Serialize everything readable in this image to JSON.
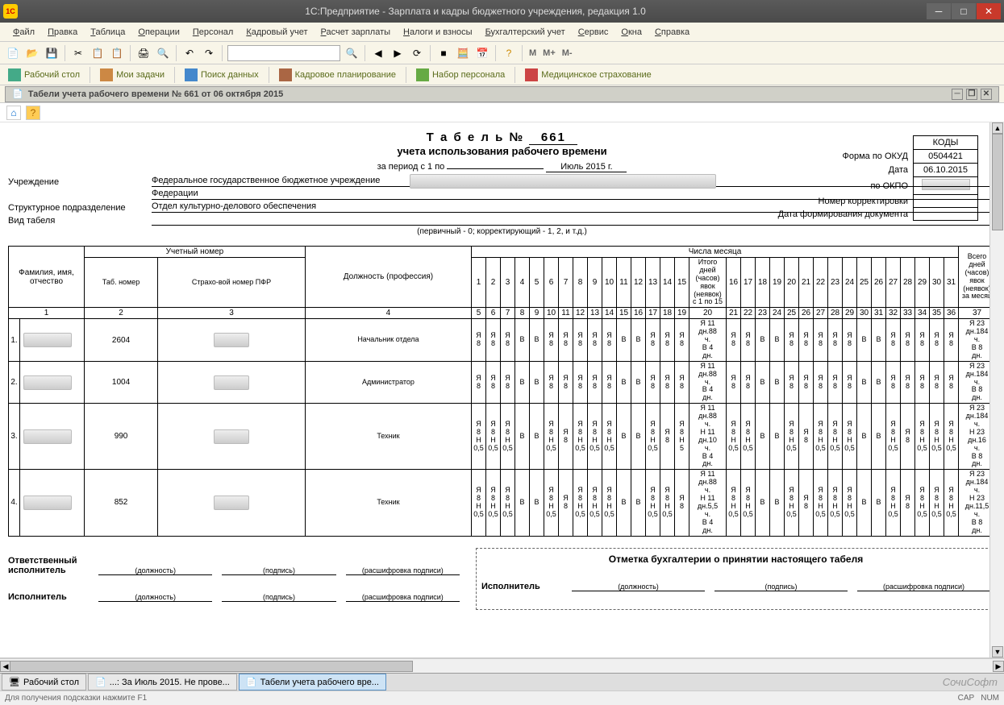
{
  "window": {
    "title": "1С:Предприятие - Зарплата и кадры бюджетного учреждения, редакция 1.0"
  },
  "menu": [
    "Файл",
    "Правка",
    "Таблица",
    "Операции",
    "Персонал",
    "Кадровый учет",
    "Расчет зарплаты",
    "Налоги и взносы",
    "Бухгалтерский учет",
    "Сервис",
    "Окна",
    "Справка"
  ],
  "toolbar": {
    "m": "M",
    "mp": "M+",
    "mm": "M-"
  },
  "toolbar2": {
    "desktop": "Рабочий стол",
    "tasks": "Мои задачи",
    "search": "Поиск данных",
    "plan": "Кадровое планирование",
    "recruit": "Набор персонала",
    "med": "Медицинское страхование"
  },
  "doc": {
    "tab_title": "Табели учета рабочего времени № 661 от 06 октября 2015"
  },
  "report": {
    "title": "Т а б е л ь №",
    "num": "661",
    "subtitle": "учета использования рабочего времени",
    "period_lab": "за период с 1 по",
    "period_val": "Июль 2015 г.",
    "org_lab": "Учреждение",
    "org_val": "Федеральное государственное бюджетное учреждение",
    "org_end": "Федерации",
    "dept_lab": "Структурное подразделение",
    "dept_val": "Отдел культурно-делового обеспечения",
    "type_lab": "Вид табеля",
    "type_note": "(первичный - 0; корректирующий - 1, 2, и т.д.)",
    "codes": {
      "header": "КОДЫ",
      "okud_lab": "Форма по ОКУД",
      "okud": "0504421",
      "date_lab": "Дата",
      "date": "06.10.2015",
      "okpo_lab": "по ОКПО",
      "okpo": "",
      "corr_lab": "Номер корректировки",
      "corr": "",
      "formdate_lab": "Дата формирования документа",
      "formdate": ""
    }
  },
  "table": {
    "h_fio": "Фамилия, имя, отчество",
    "h_uchet": "Учетный номер",
    "h_tab": "Таб. номер",
    "h_snils": "Страхо-вой номер ПФР",
    "h_pos": "Должность (профессия)",
    "h_days": "Числа месяца",
    "h_itogo": "Итого дней (часов) явок (неявок) с 1 по 15",
    "h_vsego": "Всего дней (часов) явок (неявок) за месяц",
    "colnums": [
      "1",
      "2",
      "3",
      "4",
      "5",
      "6",
      "7",
      "8",
      "9",
      "10",
      "11",
      "12",
      "13",
      "14",
      "15",
      "16",
      "17",
      "18",
      "19",
      "20",
      "21",
      "22",
      "23",
      "24",
      "25",
      "26",
      "27",
      "28",
      "29",
      "30",
      "31",
      "32",
      "33",
      "34",
      "35",
      "36",
      "37"
    ],
    "days1": [
      "1",
      "2",
      "3",
      "4",
      "5",
      "6",
      "7",
      "8",
      "9",
      "10",
      "11",
      "12",
      "13",
      "14",
      "15"
    ],
    "days2": [
      "16",
      "17",
      "18",
      "19",
      "20",
      "21",
      "22",
      "23",
      "24",
      "25",
      "26",
      "27",
      "28",
      "29",
      "30",
      "31"
    ],
    "rows": [
      {
        "n": "1",
        "tab": "2604",
        "pos": "Начальник отдела",
        "d1": [
          "Я 8",
          "Я 8",
          "Я 8",
          "В",
          "В",
          "Я 8",
          "Я 8",
          "Я 8",
          "Я 8",
          "Я 8",
          "В",
          "В",
          "Я 8",
          "Я 8",
          "Я 8"
        ],
        "m": "Я 11 дн.88 ч. В 4 дн.",
        "d2": [
          "Я 8",
          "Я 8",
          "В",
          "В",
          "Я 8",
          "Я 8",
          "Я 8",
          "Я 8",
          "Я 8",
          "В",
          "В",
          "Я 8",
          "Я 8",
          "Я 8",
          "Я 8",
          "Я 8"
        ],
        "t": "Я 23 дн.184 ч. В 8 дн."
      },
      {
        "n": "2",
        "tab": "1004",
        "pos": "Администратор",
        "d1": [
          "Я 8",
          "Я 8",
          "Я 8",
          "В",
          "В",
          "Я 8",
          "Я 8",
          "Я 8",
          "Я 8",
          "Я 8",
          "В",
          "В",
          "Я 8",
          "Я 8",
          "Я 8"
        ],
        "m": "Я 11 дн.88 ч. В 4 дн.",
        "d2": [
          "Я 8",
          "Я 8",
          "В",
          "В",
          "Я 8",
          "Я 8",
          "Я 8",
          "Я 8",
          "Я 8",
          "В",
          "В",
          "Я 8",
          "Я 8",
          "Я 8",
          "Я 8",
          "Я 8"
        ],
        "t": "Я 23 дн.184 ч. В 8 дн."
      },
      {
        "n": "3",
        "tab": "990",
        "pos": "Техник",
        "d1": [
          "Я 8 Н 0,5",
          "Я 8 Н 0,5",
          "Я 8 Н 0,5",
          "В",
          "В",
          "Я 8 Н 0,5",
          "Я 8",
          "Я 8 Н 0,5",
          "Я 8 Н 0,5",
          "Я 8 Н 0,5",
          "В",
          "В",
          "Я 8 Н 0,5",
          "Я 8",
          "Я 8 Н 5"
        ],
        "m": "Я 11 дн.88 ч. Н 11 дн.10 ч. В 4 дн.",
        "d2": [
          "Я 8 Н 0,5",
          "Я 8 Н 0,5",
          "В",
          "В",
          "Я 8 Н 0,5",
          "Я 8",
          "Я 8 Н 0,5",
          "Я 8 Н 0,5",
          "Я 8 Н 0,5",
          "В",
          "В",
          "Я 8 Н 0,5",
          "Я 8",
          "Я 8 Н 0,5",
          "Я 8 Н 0,5",
          "Я 8 Н 0,5"
        ],
        "t": "Я 23 дн.184 ч. Н 23 дн.16 ч. В 8 дн."
      },
      {
        "n": "4",
        "tab": "852",
        "pos": "Техник",
        "d1": [
          "Я 8 Н 0,5",
          "Я 8 Н 0,5",
          "Я 8 Н 0,5",
          "В",
          "В",
          "Я 8 Н 0,5",
          "Я 8",
          "Я 8 Н 0,5",
          "Я 8 Н 0,5",
          "Я 8 Н 0,5",
          "В",
          "В",
          "Я 8 Н 0,5",
          "Я 8 Н 0,5",
          "Я 8"
        ],
        "m": "Я 11 дн.88 ч. Н 11 дн.5,5 ч. В 4 дн.",
        "d2": [
          "Я 8 Н 0,5",
          "Я 8 Н 0,5",
          "В",
          "В",
          "Я 8 Н 0,5",
          "Я 8",
          "Я 8 Н 0,5",
          "Я 8 Н 0,5",
          "Я 8 Н 0,5",
          "В",
          "В",
          "Я 8 Н 0,5",
          "Я 8",
          "Я 8 Н 0,5",
          "Я 8 Н 0,5",
          "Я 8 Н 0,5"
        ],
        "t": "Я 23 дн.184 ч. Н 23 дн.11,5 ч. В 8 дн."
      }
    ]
  },
  "sign": {
    "resp": "Ответственный исполнитель",
    "exec": "Исполнитель",
    "pos": "(должность)",
    "sig": "(подпись)",
    "dec": "(расшифровка подписи)",
    "acc_title": "Отметка бухгалтерии о принятии настоящего табеля"
  },
  "bottom": {
    "t1": "Рабочий стол",
    "t2": "...: За Июль 2015. Не прове...",
    "t3": "Табели учета рабочего вре...",
    "brand": "СочиСофт"
  },
  "status": {
    "hint": "Для получения подсказки нажмите F1",
    "cap": "CAP",
    "num": "NUM"
  }
}
